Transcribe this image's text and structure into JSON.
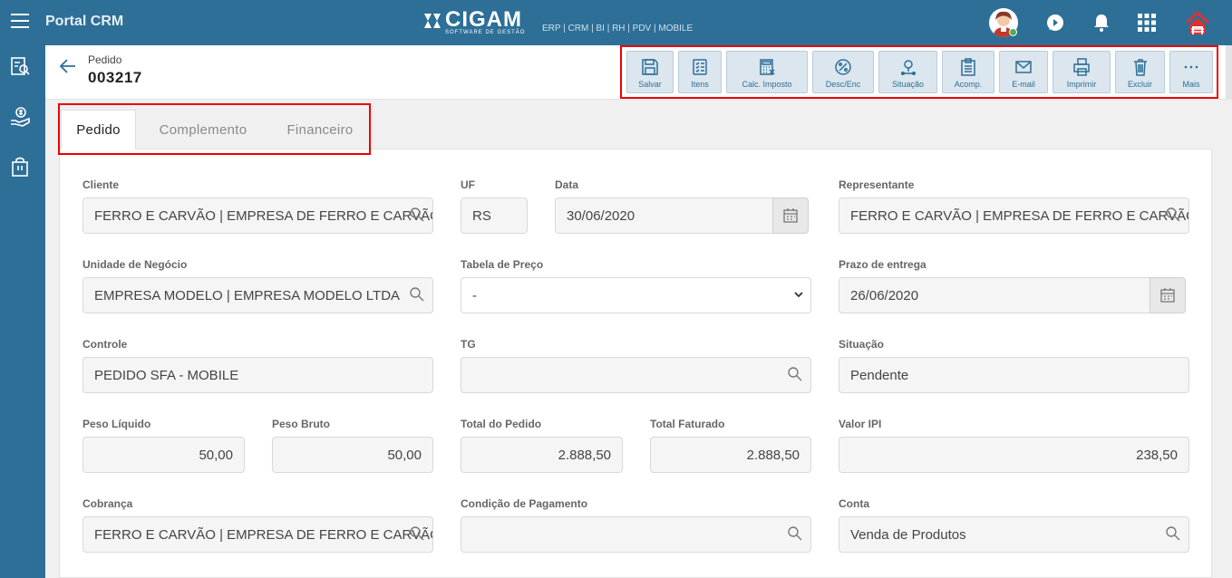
{
  "app": {
    "title": "Portal CRM"
  },
  "brand": {
    "name": "CIGAM",
    "tagline": "SOFTWARE DE GESTÃO",
    "modules": "ERP | CRM | BI | RH | PDV | MOBILE"
  },
  "header": {
    "label": "Pedido",
    "value": "003217"
  },
  "toolbar": [
    {
      "label": "Salvar",
      "icon": "save-icon"
    },
    {
      "label": "Itens",
      "icon": "list-icon"
    },
    {
      "label": "Calc. Imposto",
      "icon": "calculator-icon"
    },
    {
      "label": "Desc/Enc",
      "icon": "percent-icon"
    },
    {
      "label": "Situação",
      "icon": "location-icon"
    },
    {
      "label": "Acomp.",
      "icon": "clipboard-icon"
    },
    {
      "label": "E-mail",
      "icon": "email-icon"
    },
    {
      "label": "Imprimir",
      "icon": "print-icon"
    },
    {
      "label": "Excluir",
      "icon": "trash-icon"
    },
    {
      "label": "Mais",
      "icon": "more-icon"
    }
  ],
  "tabs": [
    {
      "label": "Pedido",
      "active": true
    },
    {
      "label": "Complemento",
      "active": false
    },
    {
      "label": "Financeiro",
      "active": false
    }
  ],
  "form": {
    "cliente": {
      "label": "Cliente",
      "value": "FERRO E CARVÃO | EMPRESA DE FERRO E CARVÃO LTDA"
    },
    "uf": {
      "label": "UF",
      "value": "RS"
    },
    "data": {
      "label": "Data",
      "value": "30/06/2020"
    },
    "representante": {
      "label": "Representante",
      "value": "FERRO E CARVÃO | EMPRESA DE FERRO E CARVÃO LTDA"
    },
    "unidade": {
      "label": "Unidade de Negócio",
      "value": "EMPRESA MODELO | EMPRESA MODELO LTDA"
    },
    "tabela": {
      "label": "Tabela de Preço",
      "value": "-"
    },
    "prazo": {
      "label": "Prazo de entrega",
      "value": "26/06/2020"
    },
    "controle": {
      "label": "Controle",
      "value": "PEDIDO SFA - MOBILE"
    },
    "tg": {
      "label": "TG",
      "value": ""
    },
    "situacao": {
      "label": "Situação",
      "value": "Pendente"
    },
    "peso_liquido": {
      "label": "Peso Líquido",
      "value": "50,00"
    },
    "peso_bruto": {
      "label": "Peso Bruto",
      "value": "50,00"
    },
    "total_pedido": {
      "label": "Total do Pedido",
      "value": "2.888,50"
    },
    "total_faturado": {
      "label": "Total Faturado",
      "value": "2.888,50"
    },
    "valor_ipi": {
      "label": "Valor IPI",
      "value": "238,50"
    },
    "cobranca": {
      "label": "Cobrança",
      "value": "FERRO E CARVÃO | EMPRESA DE FERRO E CARVÃO LTDA"
    },
    "condicao": {
      "label": "Condição de Pagamento",
      "value": ""
    },
    "conta": {
      "label": "Conta",
      "value": "Venda de Produtos"
    }
  },
  "colors": {
    "primary": "#2d6f97",
    "highlight": "#ee0000",
    "toolbar_bg": "#dbe6ee"
  }
}
